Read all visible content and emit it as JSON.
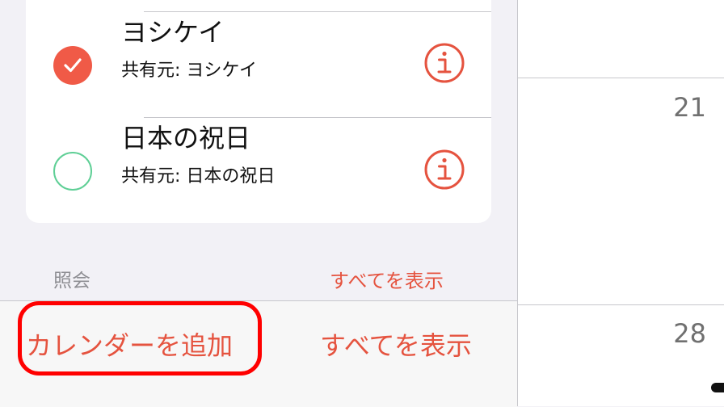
{
  "calendars": [
    {
      "name": "ヨシケイ",
      "shared_from": "共有元: ヨシケイ",
      "checked": true,
      "color": "#f05a47"
    },
    {
      "name": "日本の祝日",
      "shared_from": "共有元: 日本の祝日",
      "checked": false,
      "color": "#5fcf96"
    }
  ],
  "section": {
    "header": "照会",
    "link": "すべてを表示"
  },
  "toolbar": {
    "add_calendar": "カレンダーを追加",
    "show_all": "すべてを表示"
  },
  "calendar_days": [
    "21",
    "28"
  ],
  "colors": {
    "accent": "#e5533f",
    "highlight": "#ff0000"
  }
}
